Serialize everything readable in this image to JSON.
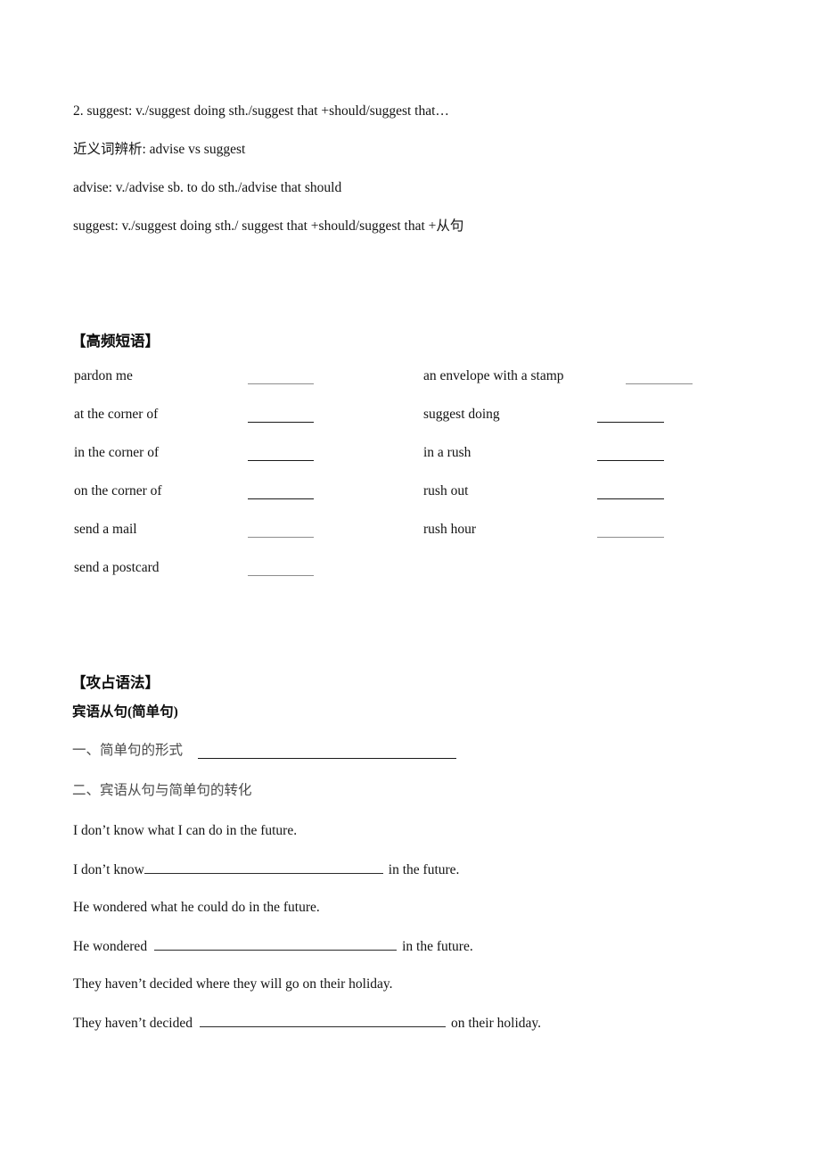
{
  "vocab": {
    "entry_line": "2. suggest: v./suggest doing sth./suggest that +should/suggest that…",
    "compare_line": "近义词辨析: advise vs suggest",
    "advise_line": "advise: v./advise sb. to do sth./advise that should",
    "suggest_line": "suggest: v./suggest doing sth./ suggest that +should/suggest that +从句"
  },
  "phrases_section": {
    "heading": "【高频短语】",
    "left_column": [
      {
        "text": "pardon me"
      },
      {
        "text": "at the corner of"
      },
      {
        "text": "in the corner of"
      },
      {
        "text": "on the corner of"
      },
      {
        "text": "send a mail"
      },
      {
        "text": "send a postcard"
      }
    ],
    "right_column": [
      {
        "text": "an envelope with a stamp"
      },
      {
        "text": "suggest doing"
      },
      {
        "text": "in a rush"
      },
      {
        "text": "rush out"
      },
      {
        "text": "rush hour"
      }
    ]
  },
  "grammar_section": {
    "heading": "【攻占语法】",
    "subheading": "宾语从句(简单句)",
    "item_one_label": "一、简单句的形式",
    "item_two_label": "二、宾语从句与简单句的转化",
    "exercises": [
      {
        "model": "I don’t know what I can do in the future.",
        "prefix": "I don’t know",
        "suffix": "in the future."
      },
      {
        "model": "He wondered what he could do in the future.",
        "prefix": "He wondered",
        "suffix": "in the future."
      },
      {
        "model": "They haven’t decided where they will go on their holiday.",
        "prefix": "They haven’t decided",
        "suffix": "on their holiday."
      }
    ]
  }
}
